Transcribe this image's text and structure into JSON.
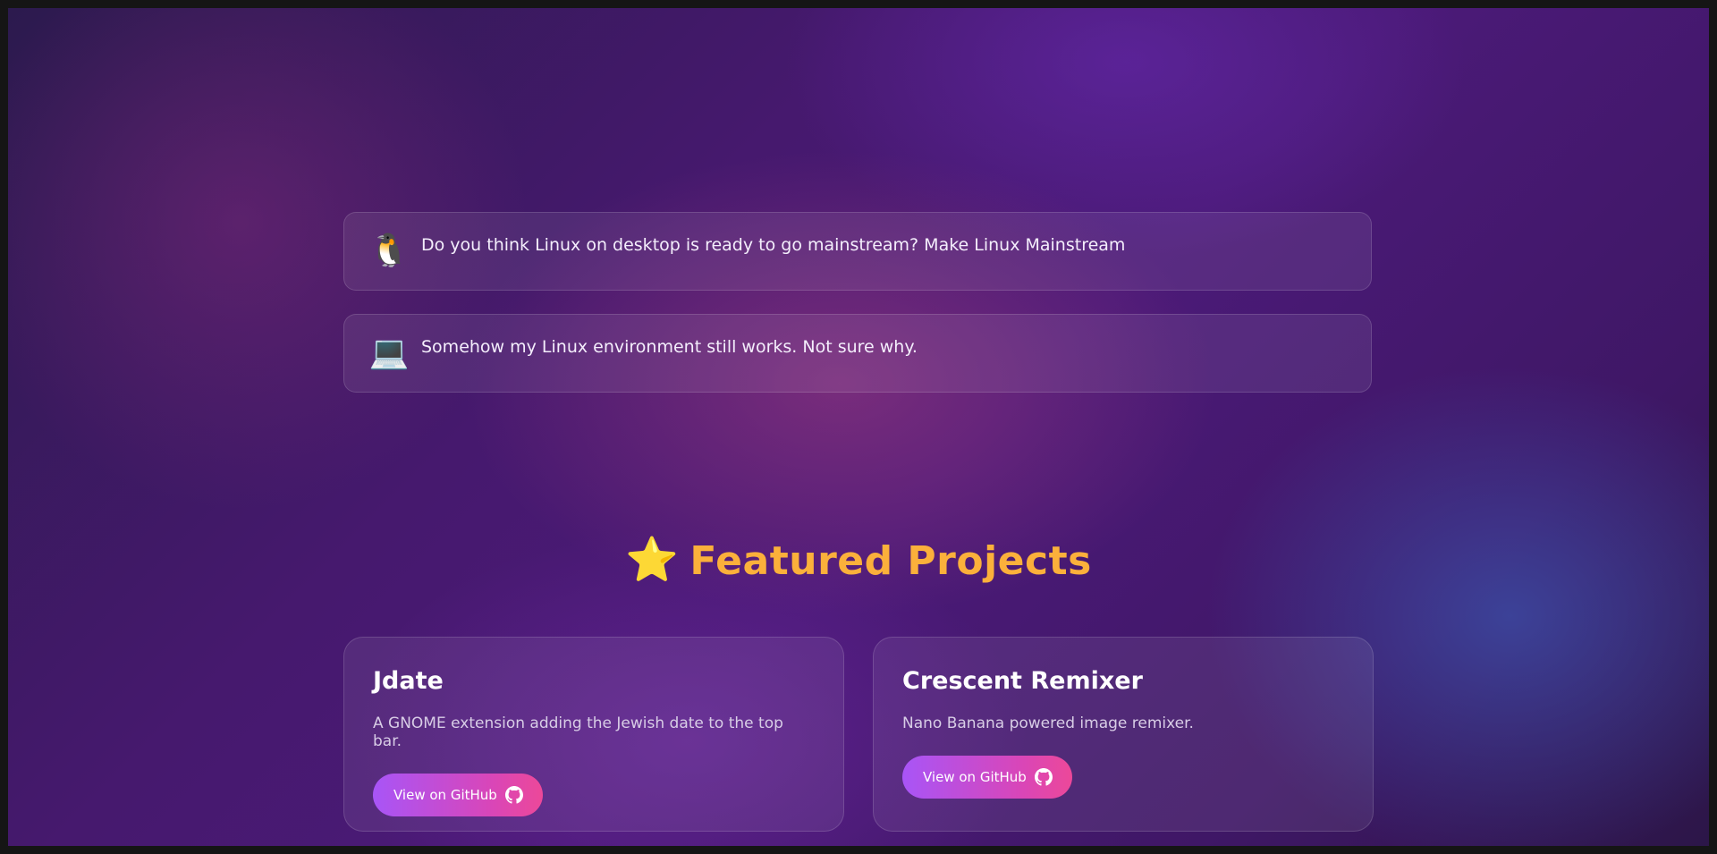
{
  "messages": [
    {
      "emoji_icon": "penguin-icon",
      "emoji": "🐧",
      "text": "Do you think Linux on desktop is ready to go mainstream? Make Linux Mainstream"
    },
    {
      "emoji_icon": "laptop-icon",
      "emoji": "💻",
      "text": "Somehow my Linux environment still works. Not sure why."
    }
  ],
  "featured": {
    "star": "⭐",
    "title": "Featured Projects"
  },
  "projects": [
    {
      "name": "Jdate",
      "description": "A GNOME extension adding the Jewish date to the top bar.",
      "button_label": "View on GitHub"
    },
    {
      "name": "Crescent Remixer",
      "description": "Nano Banana powered image remixer.",
      "button_label": "View on GitHub"
    }
  ],
  "colors": {
    "title": "#fbb03b",
    "button_start": "#a855f7",
    "button_end": "#ec4899",
    "background": "#46196e"
  }
}
